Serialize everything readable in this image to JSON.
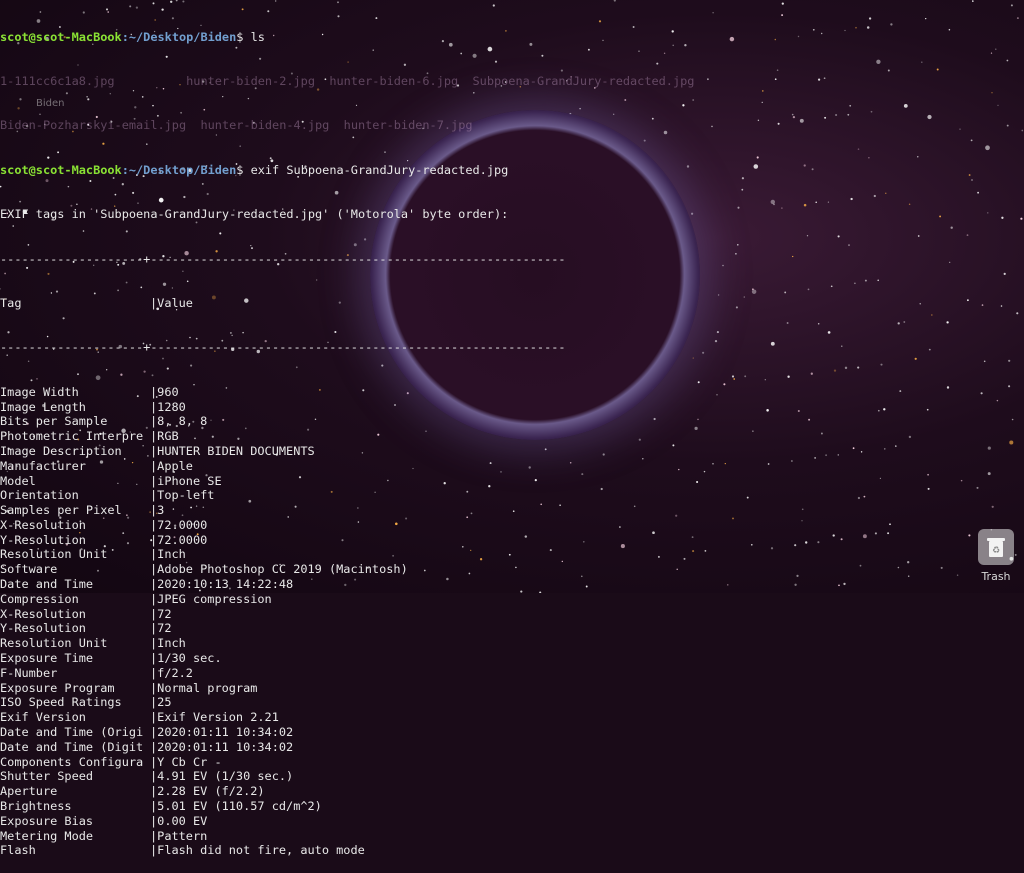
{
  "desktop": {
    "folder_label": "Biden",
    "trash_label": "Trash"
  },
  "terminal": {
    "prompt_user": "scot@scot-MacBook",
    "prompt_path": ":~/Desktop/Biden",
    "prompt_symbol": "$",
    "command_ls": " ls",
    "ls_row1": [
      "1-111cc6c1a8.jpg",
      "hunter-biden-2.jpg",
      "hunter-biden-6.jpg",
      "Subpoena-GrandJury-redacted.jpg"
    ],
    "ls_row2": [
      "Biden-Pozharskyi-email.jpg",
      "hunter-biden-4.jpg",
      "hunter-biden-7.jpg"
    ],
    "command_exif": " exif Subpoena-GrandJury-redacted.jpg",
    "exif_header": "EXIF tags in 'Subpoena-GrandJury-redacted.jpg' ('Motorola' byte order):",
    "separator_top": "--------------------+----------------------------------------------------------",
    "col_tag": "Tag",
    "col_value": "Value",
    "separator_mid": "--------------------+----------------------------------------------------------",
    "rows": [
      {
        "tag": "Image Width",
        "value": "960"
      },
      {
        "tag": "Image Length",
        "value": "1280"
      },
      {
        "tag": "Bits per Sample",
        "value": "8, 8, 8"
      },
      {
        "tag": "Photometric Interpre",
        "value": "RGB"
      },
      {
        "tag": "Image Description",
        "value": "HUNTER BIDEN DOCUMENTS"
      },
      {
        "tag": "Manufacturer",
        "value": "Apple"
      },
      {
        "tag": "Model",
        "value": "iPhone SE"
      },
      {
        "tag": "Orientation",
        "value": "Top-left"
      },
      {
        "tag": "Samples per Pixel",
        "value": "3"
      },
      {
        "tag": "X-Resolution",
        "value": "72.0000"
      },
      {
        "tag": "Y-Resolution",
        "value": "72.0000"
      },
      {
        "tag": "Resolution Unit",
        "value": "Inch"
      },
      {
        "tag": "Software",
        "value": "Adobe Photoshop CC 2019 (Macintosh)"
      },
      {
        "tag": "Date and Time",
        "value": "2020:10:13 14:22:48"
      },
      {
        "tag": "Compression",
        "value": "JPEG compression"
      },
      {
        "tag": "X-Resolution",
        "value": "72"
      },
      {
        "tag": "Y-Resolution",
        "value": "72"
      },
      {
        "tag": "Resolution Unit",
        "value": "Inch"
      },
      {
        "tag": "Exposure Time",
        "value": "1/30 sec."
      },
      {
        "tag": "F-Number",
        "value": "f/2.2"
      },
      {
        "tag": "Exposure Program",
        "value": "Normal program"
      },
      {
        "tag": "ISO Speed Ratings",
        "value": "25"
      },
      {
        "tag": "Exif Version",
        "value": "Exif Version 2.21"
      },
      {
        "tag": "Date and Time (Origi",
        "value": "2020:01:11 10:34:02"
      },
      {
        "tag": "Date and Time (Digit",
        "value": "2020:01:11 10:34:02"
      },
      {
        "tag": "Components Configura",
        "value": "Y Cb Cr -"
      },
      {
        "tag": "Shutter Speed",
        "value": "4.91 EV (1/30 sec.)"
      },
      {
        "tag": "Aperture",
        "value": "2.28 EV (f/2.2)"
      },
      {
        "tag": "Brightness",
        "value": "5.01 EV (110.57 cd/m^2)"
      },
      {
        "tag": "Exposure Bias",
        "value": "0.00 EV"
      },
      {
        "tag": "Metering Mode",
        "value": "Pattern"
      },
      {
        "tag": "Flash",
        "value": "Flash did not fire, auto mode"
      }
    ]
  }
}
